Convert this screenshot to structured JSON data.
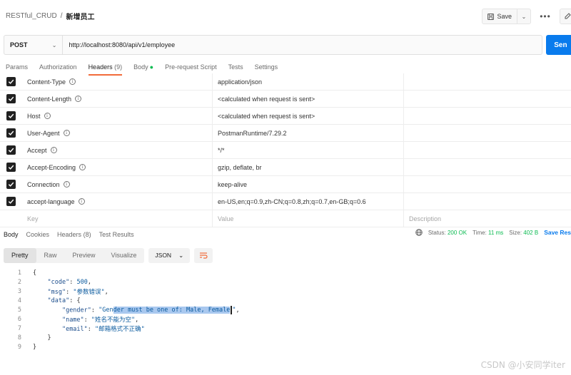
{
  "breadcrumb": {
    "collection": "RESTful_CRUD",
    "separator": "/",
    "request": "新增员工"
  },
  "toolbar": {
    "save_label": "Save",
    "more_label": "•••"
  },
  "request": {
    "method": "POST",
    "url": "http://localhost:8080/api/v1/employee",
    "send_label": "Sen"
  },
  "request_tabs": [
    {
      "label": "Params"
    },
    {
      "label": "Authorization"
    },
    {
      "label": "Headers",
      "count": "(9)"
    },
    {
      "label": "Body",
      "dot": "●"
    },
    {
      "label": "Pre-request Script"
    },
    {
      "label": "Tests"
    },
    {
      "label": "Settings"
    }
  ],
  "headers": [
    {
      "key": "Content-Type",
      "value": "application/json",
      "checked": true
    },
    {
      "key": "Content-Length",
      "value": "<calculated when request is sent>",
      "checked": true
    },
    {
      "key": "Host",
      "value": "<calculated when request is sent>",
      "checked": true
    },
    {
      "key": "User-Agent",
      "value": "PostmanRuntime/7.29.2",
      "checked": true
    },
    {
      "key": "Accept",
      "value": "*/*",
      "checked": true
    },
    {
      "key": "Accept-Encoding",
      "value": "gzip, deflate, br",
      "checked": true
    },
    {
      "key": "Connection",
      "value": "keep-alive",
      "checked": true
    },
    {
      "key": "accept-language",
      "value": "en-US,en;q=0.9,zh-CN;q=0.8,zh;q=0.7,en-GB;q=0.6",
      "checked": true
    }
  ],
  "header_placeholders": {
    "key": "Key",
    "value": "Value",
    "description": "Description"
  },
  "response_tabs": [
    {
      "label": "Body"
    },
    {
      "label": "Cookies"
    },
    {
      "label": "Headers",
      "count": "(8)"
    },
    {
      "label": "Test Results"
    }
  ],
  "response_status": {
    "status_label": "Status:",
    "status_value": "200 OK",
    "time_label": "Time:",
    "time_value": "11 ms",
    "size_label": "Size:",
    "size_value": "402 B",
    "save_response_label": "Save Res"
  },
  "response_formats": [
    "Pretty",
    "Raw",
    "Preview",
    "Visualize"
  ],
  "response_language": "JSON",
  "code_lines": [
    {
      "n": "1",
      "text": "{"
    },
    {
      "n": "2",
      "text": "    \"code\": 500,"
    },
    {
      "n": "3",
      "text": "    \"msg\": \"参数错误\","
    },
    {
      "n": "4",
      "text": "    \"data\": {"
    },
    {
      "n": "5",
      "text": "        \"gender\": \"Gender must be one of: Male, Female\","
    },
    {
      "n": "6",
      "text": "        \"name\": \"姓名不能为空\","
    },
    {
      "n": "7",
      "text": "        \"email\": \"邮箱格式不正确\""
    },
    {
      "n": "8",
      "text": "    }"
    },
    {
      "n": "9",
      "text": "}"
    }
  ],
  "watermark": "CSDN @小安同学iter",
  "colors": {
    "send": "#097bed",
    "active_tab_underline": "#f26b3a",
    "status_ok": "#0cbb52"
  }
}
